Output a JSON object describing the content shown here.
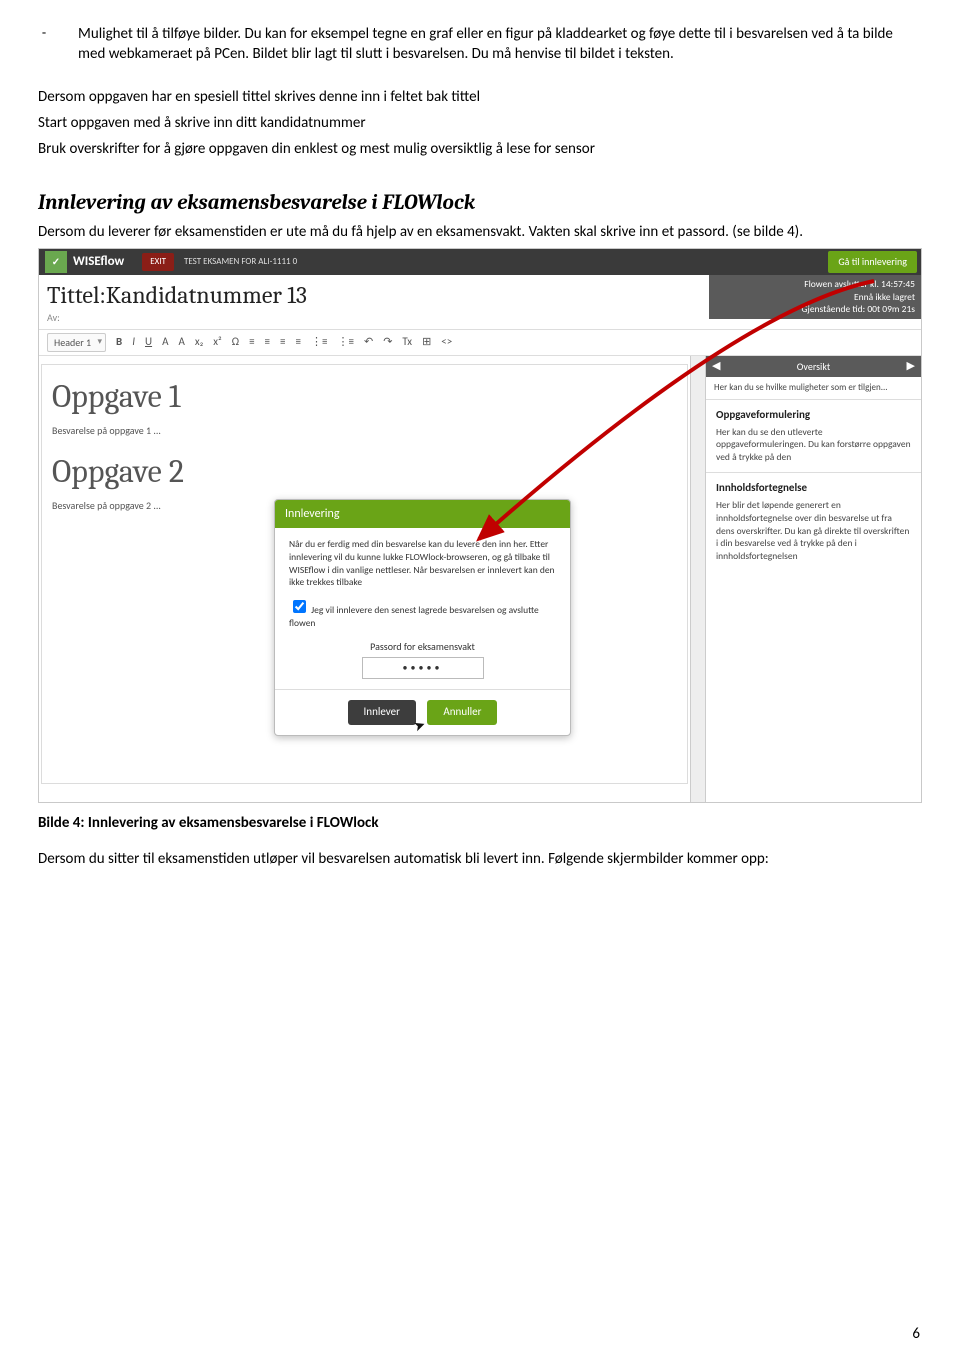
{
  "bullet": {
    "dash": "-",
    "text": "Mulighet til å tilføye bilder. Du kan for eksempel tegne en graf eller en figur på kladdearket og føye dette til i besvarelsen ved å ta bilde med webkameraet på PCen. Bildet blir lagt til slutt i besvarelsen. Du må henvise til bildet i teksten."
  },
  "lines": {
    "l1": "Dersom oppgaven har en spesiell tittel skrives denne inn i feltet bak tittel",
    "l2": "Start oppgaven med å skrive inn ditt kandidatnummer",
    "l3": "Bruk overskrifter for å gjøre oppgaven din enklest og mest mulig oversiktlig å lese for sensor"
  },
  "section": {
    "title": "Innlevering av eksamensbesvarelse i FLOWlock",
    "intro": "Dersom du leverer før eksamenstiden er ute må du få hjelp av en eksamensvakt. Vakten skal skrive inn et passord. (se bilde 4)."
  },
  "shot": {
    "brand": "WISEflow",
    "exit": "EXIT",
    "test": "TEST EKSAMEN FOR ALI-1111 0",
    "go": "Gå til innlevering",
    "title_prefix": "Tittel:",
    "title_value": "Kandidatnummer 13",
    "av": "Av:",
    "status1": "Flowen avslutter kl. 14:57:45",
    "status2": "Ennå ikke lagret",
    "status3": "Gjenstående tid: 00t 09m 21s",
    "toolbar": {
      "header": "Header 1",
      "b": "B",
      "i": "I",
      "u": "U",
      "a1": "A",
      "a2": "A",
      "sub": "x₂",
      "sup": "x²",
      "omega": "Ω",
      "alignL": "≡",
      "alignC": "≡",
      "alignR": "≡",
      "alignJ": "≡",
      "listB": "⋮≡",
      "listN": "⋮≡",
      "undo": "↶",
      "redo": "↷",
      "clear": "Tx",
      "table": "⊞",
      "code": "<>"
    },
    "editor": {
      "h1a": "Oppgave 1",
      "a1": "Besvarelse på oppgave 1 ...",
      "h1b": "Oppgave 2",
      "a2": "Besvarelse på oppgave 2 ..."
    },
    "ov": {
      "title": "Oversikt",
      "hint": "Her kan du se hvilke muligheter som er tilgjen...",
      "b1t": "Oppgaveformulering",
      "b1d": "Her kan du se den utleverte oppgaveformuleringen. Du kan forstørre oppgaven ved å trykke på den",
      "b2t": "Innholdsfortegnelse",
      "b2d": "Her blir det løpende generert en innholdsfortegnelse over din besvarelse ut fra dens overskrifter. Du kan gå direkte til overskriften i din besvarelse ved å trykke på den i innholdsfortegnelsen"
    },
    "modal": {
      "title": "Innlevering",
      "body": "Når du er ferdig med din besvarelse kan du levere den inn her. Etter innlevering vil du kunne lukke FLOWlock-browseren, og gå tilbake til WISEflow i din vanlige nettleser. Når besvarelsen er innlevert kan den ikke trekkes tilbake",
      "chk": "Jeg vil innlevere den senest lagrede besvarelsen og avslutte flowen",
      "pwlabel": "Passord for eksamensvakt",
      "pwval": "•••••",
      "submit": "Innlever",
      "cancel": "Annuller"
    }
  },
  "caption": "Bilde 4: Innlevering av eksamensbesvarelse i FLOWlock",
  "outro": "Dersom du sitter til eksamenstiden utløper vil besvarelsen automatisk bli levert inn. Følgende skjermbilder kommer opp:",
  "pageno": "6"
}
